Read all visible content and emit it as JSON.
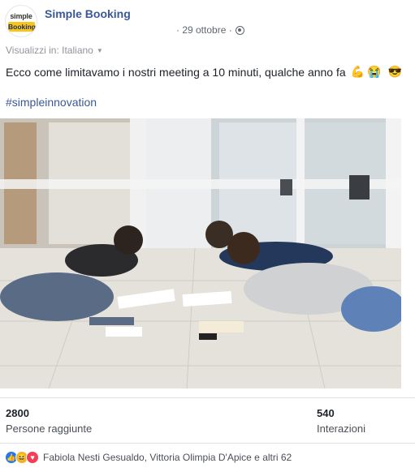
{
  "header": {
    "page_name": "Simple Booking",
    "logo_top": "simple",
    "logo_bottom": "Booking",
    "date": "· 29 ottobre ·",
    "globe_icon": "globe-icon"
  },
  "translation": {
    "label": "Visualizzi in: Italiano",
    "caret_icon": "caret-down-icon"
  },
  "post": {
    "text": "Ecco come limitavamo i nostri meeting a 10 minuti, qualche anno fa",
    "emojis": [
      "💪",
      "😭",
      "😎"
    ],
    "hashtag": "#simpleinnovation"
  },
  "photo": {
    "description_icon": "meeting-photo"
  },
  "stats": {
    "reach_value": "2800",
    "reach_label": "Persone raggiunte",
    "interactions_value": "540",
    "interactions_label": "Interazioni"
  },
  "reactions": {
    "icons": [
      "like-icon",
      "haha-icon",
      "love-icon"
    ],
    "text": "Fabiola Nesti Gesualdo, Vittoria Olimpia D'Apice e altri 62"
  },
  "colors": {
    "link": "#385898",
    "like": "#2078f4",
    "haha": "#f7b125",
    "love": "#f33e58"
  }
}
